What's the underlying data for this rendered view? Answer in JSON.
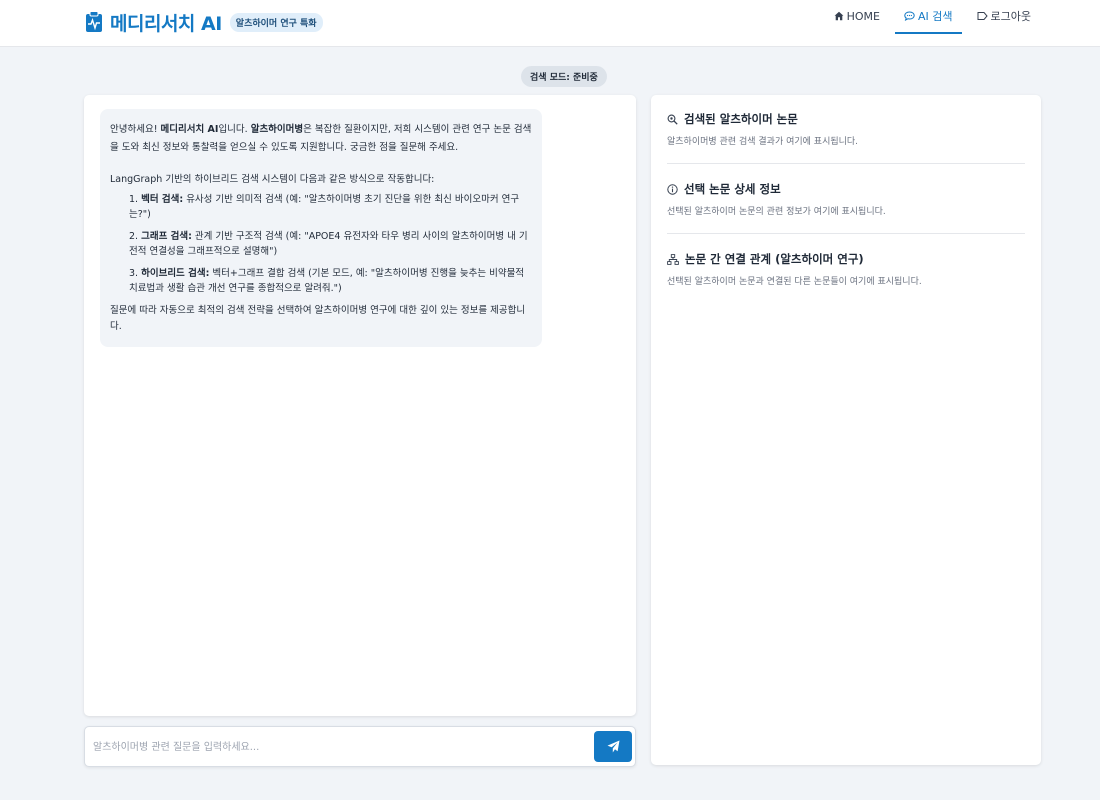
{
  "header": {
    "brand_title": "메디리서치 AI",
    "brand_badge": "알츠하이머 연구 특화",
    "nav": [
      {
        "label": "HOME",
        "icon": "home-icon"
      },
      {
        "label": "AI 검색",
        "icon": "chat-icon"
      },
      {
        "label": "로그아웃",
        "icon": "logout-icon"
      }
    ]
  },
  "mode_pill": "검색 모드: 준비중",
  "chat": {
    "intro_prefix": "안녕하세요! ",
    "intro_brand": "메디리서치 AI",
    "intro_mid": "입니다. ",
    "intro_topic": "알츠하이머병",
    "intro_rest": "은 복잡한 질환이지만, 저희 시스템이 관련 연구 논문 검색을 도와 최신 정보와 통찰력을 얻으실 수 있도록 지원합니다. 궁금한 점을 질문해 주세요.",
    "system_line": "LangGraph 기반의 하이브리드 검색 시스템이 다음과 같은 방식으로 작동합니다:",
    "methods": [
      {
        "num": "1. ",
        "name": "벡터 검색:",
        "desc": " 유사성 기반 의미적 검색 (예: \"알츠하이머병 초기 진단을 위한 최신 바이오마커 연구는?\")"
      },
      {
        "num": "2. ",
        "name": "그래프 검색:",
        "desc": " 관계 기반 구조적 검색 (예: \"APOE4 유전자와 타우 병리 사이의 알츠하이머병 내 기전적 연결성을 그래프적으로 설명해\")"
      },
      {
        "num": "3. ",
        "name": "하이브리드 검색:",
        "desc": " 벡터+그래프 결합 검색 (기본 모드, 예: \"알츠하이머병 진행을 늦추는 비약물적 치료법과 생활 습관 개선 연구를 종합적으로 알려줘.\")"
      }
    ],
    "closing": "질문에 따라 자동으로 최적의 검색 전략을 선택하여 알츠하이머병 연구에 대한 깊이 있는 정보를 제공합니다.",
    "input_placeholder": "알츠하이머병 관련 질문을 입력하세요..."
  },
  "right_panel": {
    "sections": [
      {
        "title": "검색된 알츠하이머 논문",
        "desc": "알츠하이머병 관련 검색 결과가 여기에 표시됩니다.",
        "icon": "search-icon"
      },
      {
        "title": "선택 논문 상세 정보",
        "desc": "선택된 알츠하이머 논문의 관련 정보가 여기에 표시됩니다.",
        "icon": "info-icon"
      },
      {
        "title": "논문 간 연결 관계 (알츠하이머 연구)",
        "desc": "선택된 알츠하이머 논문과 연결된 다른 논문들이 여기에 표시됩니다.",
        "icon": "network-icon"
      }
    ]
  },
  "colors": {
    "accent": "#1479c4",
    "background": "#f1f4f8",
    "bubble": "#f1f4f8"
  }
}
